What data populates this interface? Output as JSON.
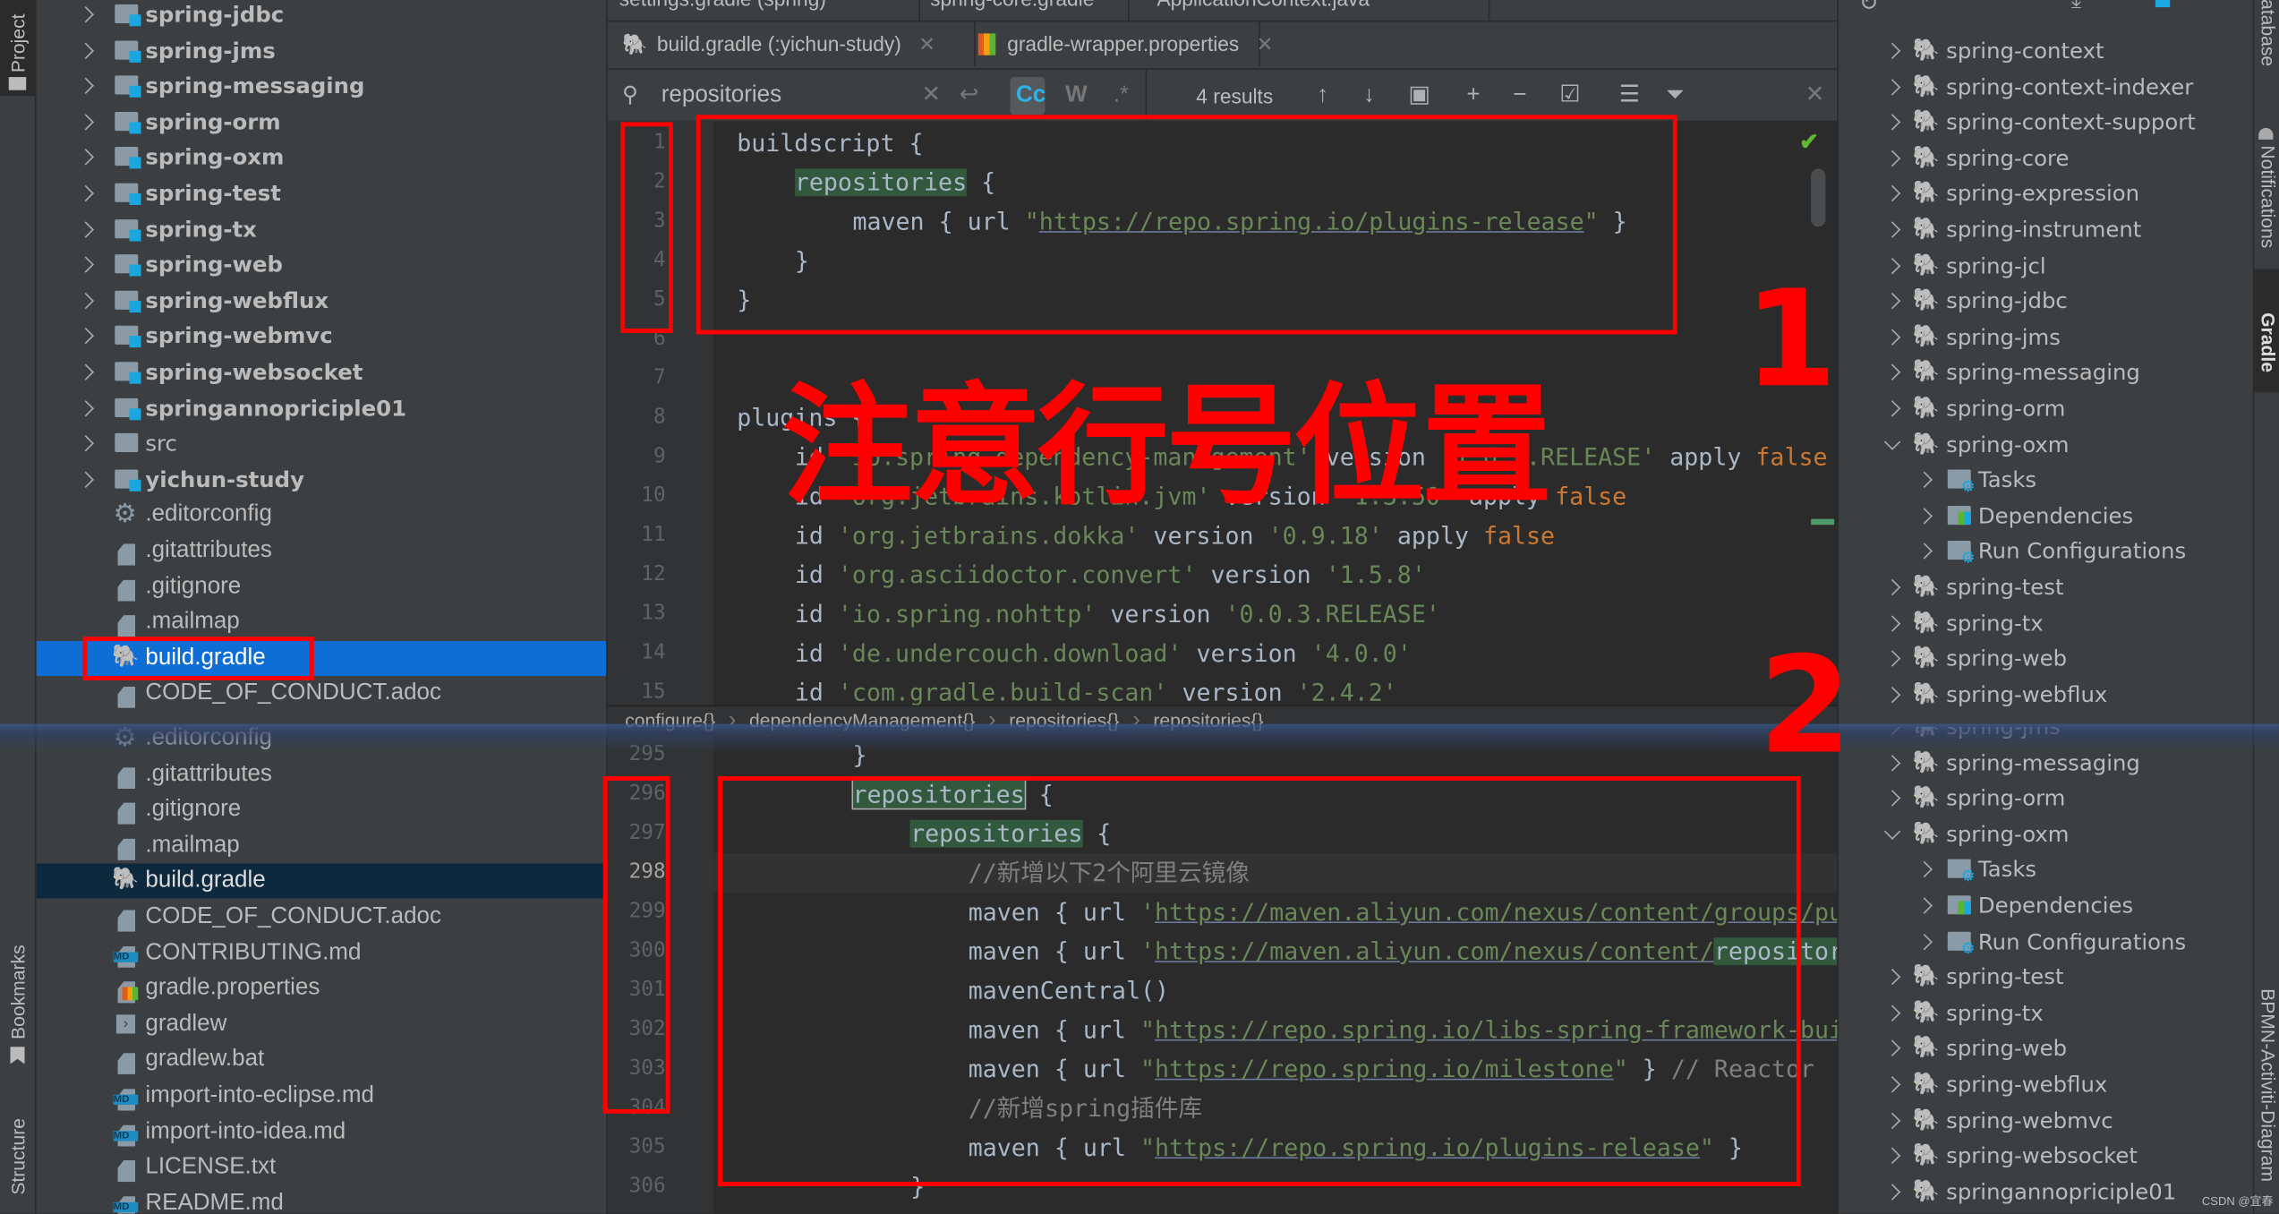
{
  "colors": {
    "accent": "#0f6dd6",
    "annotation": "#ff0000",
    "keyword": "#cc7832",
    "string": "#6a8759",
    "match": "#32593d"
  },
  "left_strip": {
    "labels": [
      "Project",
      "Bookmarks",
      "Structure"
    ]
  },
  "right_strip": {
    "labels": [
      "Database",
      "Notifications",
      "Gradle",
      "BPMN-Activiti-Diagram"
    ]
  },
  "project_top": [
    {
      "label": "spring-jdbc",
      "type": "module"
    },
    {
      "label": "spring-jms",
      "type": "module"
    },
    {
      "label": "spring-messaging",
      "type": "module"
    },
    {
      "label": "spring-orm",
      "type": "module"
    },
    {
      "label": "spring-oxm",
      "type": "module"
    },
    {
      "label": "spring-test",
      "type": "module"
    },
    {
      "label": "spring-tx",
      "type": "module"
    },
    {
      "label": "spring-web",
      "type": "module"
    },
    {
      "label": "spring-webflux",
      "type": "module"
    },
    {
      "label": "spring-webmvc",
      "type": "module"
    },
    {
      "label": "spring-websocket",
      "type": "module"
    },
    {
      "label": "springannopriciple01",
      "type": "module"
    },
    {
      "label": "src",
      "type": "folder"
    },
    {
      "label": "yichun-study",
      "type": "module"
    },
    {
      "label": ".editorconfig",
      "type": "gear"
    },
    {
      "label": ".gitattributes",
      "type": "file"
    },
    {
      "label": ".gitignore",
      "type": "file"
    },
    {
      "label": ".mailmap",
      "type": "file"
    },
    {
      "label": "build.gradle",
      "type": "gradle",
      "selected": true
    },
    {
      "label": "CODE_OF_CONDUCT.adoc",
      "type": "file"
    }
  ],
  "project_bottom": [
    {
      "label": ".editorconfig",
      "type": "gear"
    },
    {
      "label": ".gitattributes",
      "type": "file"
    },
    {
      "label": ".gitignore",
      "type": "file"
    },
    {
      "label": ".mailmap",
      "type": "file"
    },
    {
      "label": "build.gradle",
      "type": "gradle",
      "selected": true
    },
    {
      "label": "CODE_OF_CONDUCT.adoc",
      "type": "file"
    },
    {
      "label": "CONTRIBUTING.md",
      "type": "md"
    },
    {
      "label": "gradle.properties",
      "type": "props"
    },
    {
      "label": "gradlew",
      "type": "exec"
    },
    {
      "label": "gradlew.bat",
      "type": "file"
    },
    {
      "label": "import-into-eclipse.md",
      "type": "md"
    },
    {
      "label": "import-into-idea.md",
      "type": "md"
    },
    {
      "label": "LICENSE.txt",
      "type": "file"
    },
    {
      "label": "README.md",
      "type": "md"
    }
  ],
  "tabs_row1": [
    "settings.gradle (spring)",
    "spring-core.gradle",
    "ApplicationContext.java"
  ],
  "tabs_row2": [
    "build.gradle (:yichun-study)",
    "gradle-wrapper.properties"
  ],
  "search": {
    "value": "repositories",
    "match_case": "Cc",
    "words": "W",
    "regex": ".*",
    "results": "4 results"
  },
  "code_top": [
    {
      "n": "1",
      "indent": 0,
      "t": [
        [
          "k",
          "buildscript {"
        ]
      ]
    },
    {
      "n": "2",
      "indent": 4,
      "t": [
        [
          "h",
          "repositories"
        ],
        [
          "k",
          " {"
        ]
      ]
    },
    {
      "n": "3",
      "indent": 8,
      "t": [
        [
          "k",
          "maven { url "
        ],
        [
          "s",
          "\""
        ],
        [
          "u",
          "https://repo.spring.io/plugins-release"
        ],
        [
          "s",
          "\""
        ],
        [
          "k",
          " }"
        ]
      ]
    },
    {
      "n": "4",
      "indent": 4,
      "t": [
        [
          "k",
          "}"
        ]
      ]
    },
    {
      "n": "5",
      "indent": 0,
      "t": [
        [
          "k",
          "}"
        ]
      ]
    },
    {
      "n": "6",
      "indent": 0,
      "t": []
    },
    {
      "n": "7",
      "indent": 0,
      "t": []
    },
    {
      "n": "8",
      "indent": 0,
      "t": [
        [
          "k",
          "plugins {"
        ]
      ]
    },
    {
      "n": "9",
      "indent": 4,
      "t": [
        [
          "k",
          "id "
        ],
        [
          "s",
          "'io.spring.dependency-management'"
        ],
        [
          "k",
          " version "
        ],
        [
          "s",
          "'1.0.x.RELEASE'"
        ],
        [
          "k",
          " apply "
        ],
        [
          "o",
          "false"
        ]
      ]
    },
    {
      "n": "10",
      "indent": 4,
      "t": [
        [
          "k",
          "id "
        ],
        [
          "s",
          "'org.jetbrains.kotlin.jvm'"
        ],
        [
          "k",
          " version "
        ],
        [
          "s",
          "'1.3.50'"
        ],
        [
          "k",
          " apply "
        ],
        [
          "o",
          "false"
        ]
      ]
    },
    {
      "n": "11",
      "indent": 4,
      "t": [
        [
          "k",
          "id "
        ],
        [
          "s",
          "'org.jetbrains.dokka'"
        ],
        [
          "k",
          " version "
        ],
        [
          "s",
          "'0.9.18'"
        ],
        [
          "k",
          " apply "
        ],
        [
          "o",
          "false"
        ]
      ]
    },
    {
      "n": "12",
      "indent": 4,
      "t": [
        [
          "k",
          "id "
        ],
        [
          "s",
          "'org.asciidoctor.convert'"
        ],
        [
          "k",
          " version "
        ],
        [
          "s",
          "'1.5.8'"
        ]
      ]
    },
    {
      "n": "13",
      "indent": 4,
      "t": [
        [
          "k",
          "id "
        ],
        [
          "s",
          "'io.spring.nohttp'"
        ],
        [
          "k",
          " version "
        ],
        [
          "s",
          "'0.0.3.RELEASE'"
        ]
      ]
    },
    {
      "n": "14",
      "indent": 4,
      "t": [
        [
          "k",
          "id "
        ],
        [
          "s",
          "'de.undercouch.download'"
        ],
        [
          "k",
          " version "
        ],
        [
          "s",
          "'4.0.0'"
        ]
      ]
    },
    {
      "n": "15",
      "indent": 4,
      "t": [
        [
          "k",
          "id "
        ],
        [
          "s",
          "'com.gradle.build-scan'"
        ],
        [
          "k",
          " version "
        ],
        [
          "s",
          "'2.4.2'"
        ]
      ]
    }
  ],
  "breadcrumb": [
    "configure{}",
    "dependencyManagement{}",
    "repositories{}",
    "repositories{}"
  ],
  "code_bottom": [
    {
      "n": "295",
      "indent": 8,
      "t": [
        [
          "k",
          "}"
        ]
      ]
    },
    {
      "n": "296",
      "indent": 8,
      "t": [
        [
          "hb",
          "repositories"
        ],
        [
          "k",
          " {"
        ]
      ]
    },
    {
      "n": "297",
      "indent": 12,
      "t": [
        [
          "h",
          "repositories"
        ],
        [
          "k",
          " {"
        ]
      ]
    },
    {
      "n": "298",
      "indent": 16,
      "current": true,
      "t": [
        [
          "c",
          "//新增以下2个阿里云镜像"
        ]
      ]
    },
    {
      "n": "299",
      "indent": 16,
      "t": [
        [
          "k",
          "maven { url "
        ],
        [
          "s",
          "'"
        ],
        [
          "u",
          "https://maven.aliyun.com/nexus/content/groups/pu"
        ]
      ]
    },
    {
      "n": "300",
      "indent": 16,
      "t": [
        [
          "k",
          "maven { url "
        ],
        [
          "s",
          "'"
        ],
        [
          "u",
          "https://maven.aliyun.com/nexus/content/"
        ],
        [
          "h",
          "repositor"
        ]
      ]
    },
    {
      "n": "301",
      "indent": 16,
      "t": [
        [
          "k",
          "mavenCentral()"
        ]
      ]
    },
    {
      "n": "302",
      "indent": 16,
      "t": [
        [
          "k",
          "maven { url "
        ],
        [
          "s",
          "\""
        ],
        [
          "u",
          "https://repo.spring.io/libs-spring-framework-bui"
        ]
      ]
    },
    {
      "n": "303",
      "indent": 16,
      "t": [
        [
          "k",
          "maven { url "
        ],
        [
          "s",
          "\""
        ],
        [
          "u",
          "https://repo.spring.io/milestone"
        ],
        [
          "s",
          "\""
        ],
        [
          "k",
          " } "
        ],
        [
          "c",
          "// Reactor"
        ]
      ]
    },
    {
      "n": "304",
      "indent": 16,
      "t": [
        [
          "c",
          "//新增spring插件库"
        ]
      ]
    },
    {
      "n": "305",
      "indent": 16,
      "t": [
        [
          "k",
          "maven { url "
        ],
        [
          "s",
          "\""
        ],
        [
          "u",
          "https://repo.spring.io/plugins-release"
        ],
        [
          "s",
          "\""
        ],
        [
          "k",
          " }"
        ]
      ]
    },
    {
      "n": "306",
      "indent": 12,
      "t": [
        [
          "k",
          "}"
        ]
      ]
    }
  ],
  "gradle_top": [
    {
      "label": "spring-context",
      "lvl": 0
    },
    {
      "label": "spring-context-indexer",
      "lvl": 0
    },
    {
      "label": "spring-context-support",
      "lvl": 0
    },
    {
      "label": "spring-core",
      "lvl": 0
    },
    {
      "label": "spring-expression",
      "lvl": 0
    },
    {
      "label": "spring-instrument",
      "lvl": 0
    },
    {
      "label": "spring-jcl",
      "lvl": 0
    },
    {
      "label": "spring-jdbc",
      "lvl": 0
    },
    {
      "label": "spring-jms",
      "lvl": 0
    },
    {
      "label": "spring-messaging",
      "lvl": 0
    },
    {
      "label": "spring-orm",
      "lvl": 0
    },
    {
      "label": "spring-oxm",
      "lvl": 0,
      "expanded": true
    },
    {
      "label": "Tasks",
      "lvl": 1,
      "icon": "tasks"
    },
    {
      "label": "Dependencies",
      "lvl": 1,
      "icon": "deps"
    },
    {
      "label": "Run Configurations",
      "lvl": 1,
      "icon": "tasks"
    },
    {
      "label": "spring-test",
      "lvl": 0
    },
    {
      "label": "spring-tx",
      "lvl": 0
    },
    {
      "label": "spring-web",
      "lvl": 0
    },
    {
      "label": "spring-webflux",
      "lvl": 0
    }
  ],
  "gradle_bottom": [
    {
      "label": "spring-jms",
      "lvl": 0
    },
    {
      "label": "spring-messaging",
      "lvl": 0
    },
    {
      "label": "spring-orm",
      "lvl": 0
    },
    {
      "label": "spring-oxm",
      "lvl": 0,
      "expanded": true
    },
    {
      "label": "Tasks",
      "lvl": 1,
      "icon": "tasks"
    },
    {
      "label": "Dependencies",
      "lvl": 1,
      "icon": "deps"
    },
    {
      "label": "Run Configurations",
      "lvl": 1,
      "icon": "tasks"
    },
    {
      "label": "spring-test",
      "lvl": 0
    },
    {
      "label": "spring-tx",
      "lvl": 0
    },
    {
      "label": "spring-web",
      "lvl": 0
    },
    {
      "label": "spring-webflux",
      "lvl": 0
    },
    {
      "label": "spring-webmvc",
      "lvl": 0
    },
    {
      "label": "spring-websocket",
      "lvl": 0
    },
    {
      "label": "springannopriciple01",
      "lvl": 0
    }
  ],
  "annotations": {
    "note": "注意行号位置",
    "one": "1",
    "two": "2"
  },
  "watermark": "CSDN @宜春"
}
